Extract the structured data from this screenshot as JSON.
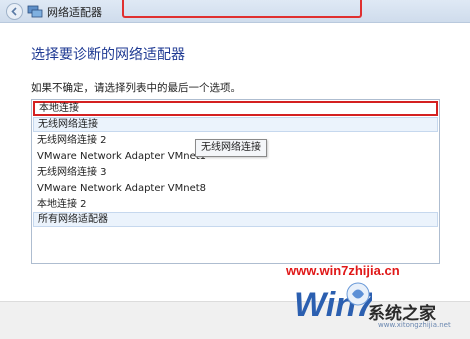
{
  "window": {
    "title": "网络适配器"
  },
  "heading": "选择要诊断的网络适配器",
  "instruction": "如果不确定，请选择列表中的最后一个选项。",
  "adapters": [
    "本地连接",
    "无线网络连接",
    "无线网络连接 2",
    "VMware Network Adapter VMnet1",
    "无线网络连接 3",
    "VMware Network Adapter VMnet8",
    "本地连接 2",
    "所有网络适配器"
  ],
  "tooltip": "无线网络连接",
  "watermark": {
    "url": "www.win7zhijia.cn",
    "logo_text": "Win7",
    "site_name": "系统之家",
    "site_url": "www.xitongzhijia.net"
  },
  "colors": {
    "heading": "#1f3a93",
    "selection_border": "#d42020",
    "watermark_red": "#e01818"
  }
}
